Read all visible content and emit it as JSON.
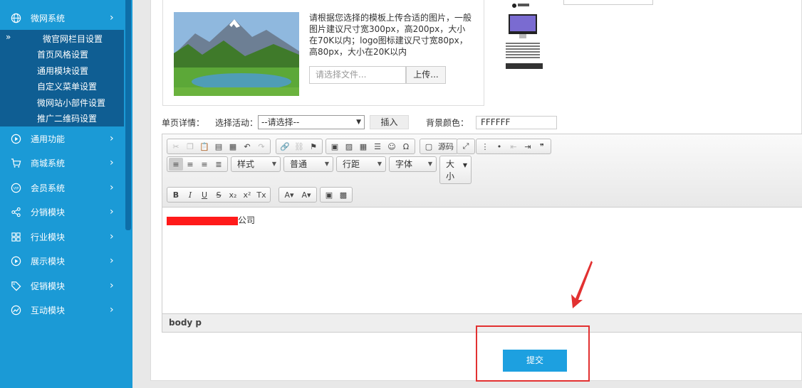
{
  "sidebar": {
    "wechat_system": "微网系统",
    "sub_items": [
      "微官网栏目设置",
      "首页风格设置",
      "通用模块设置",
      "自定义菜单设置",
      "微网站小部件设置",
      "推广二维码设置"
    ],
    "active_marker": "»",
    "items": [
      "通用功能",
      "商城系统",
      "会员系统",
      "分销模块",
      "行业模块",
      "展示模块",
      "促销模块",
      "互动模块"
    ],
    "arrow": "›"
  },
  "upload": {
    "description": "请根据您选择的模板上传合适的图片，一般图片建议尺寸宽300px，高200px，大小在70K以内；logo图标建议尺寸宽80px，高80px，大小在20K以内",
    "file_placeholder": "请选择文件...",
    "upload_button": "上传..."
  },
  "controls": {
    "detail_label": "单页详情：",
    "activity_label": "选择活动：",
    "activity_value": "--请选择--",
    "insert_button": "插入",
    "bg_color_label": "背景颜色：",
    "bg_color_value": "FFFFFF"
  },
  "editor": {
    "source_label": "源码",
    "style_combo": "样式",
    "format_combo": "普通",
    "spacing_combo": "行距",
    "font_combo": "字体",
    "size_combo_1": "大",
    "size_combo_2": "小",
    "content_suffix": "公司",
    "status_path": "body  p"
  },
  "submit": {
    "label": "提交"
  },
  "colors": {
    "sidebar": "#1b9ad6",
    "submenu": "#0f5e93",
    "accent": "#1da0e0",
    "highlight": "#e23131"
  }
}
